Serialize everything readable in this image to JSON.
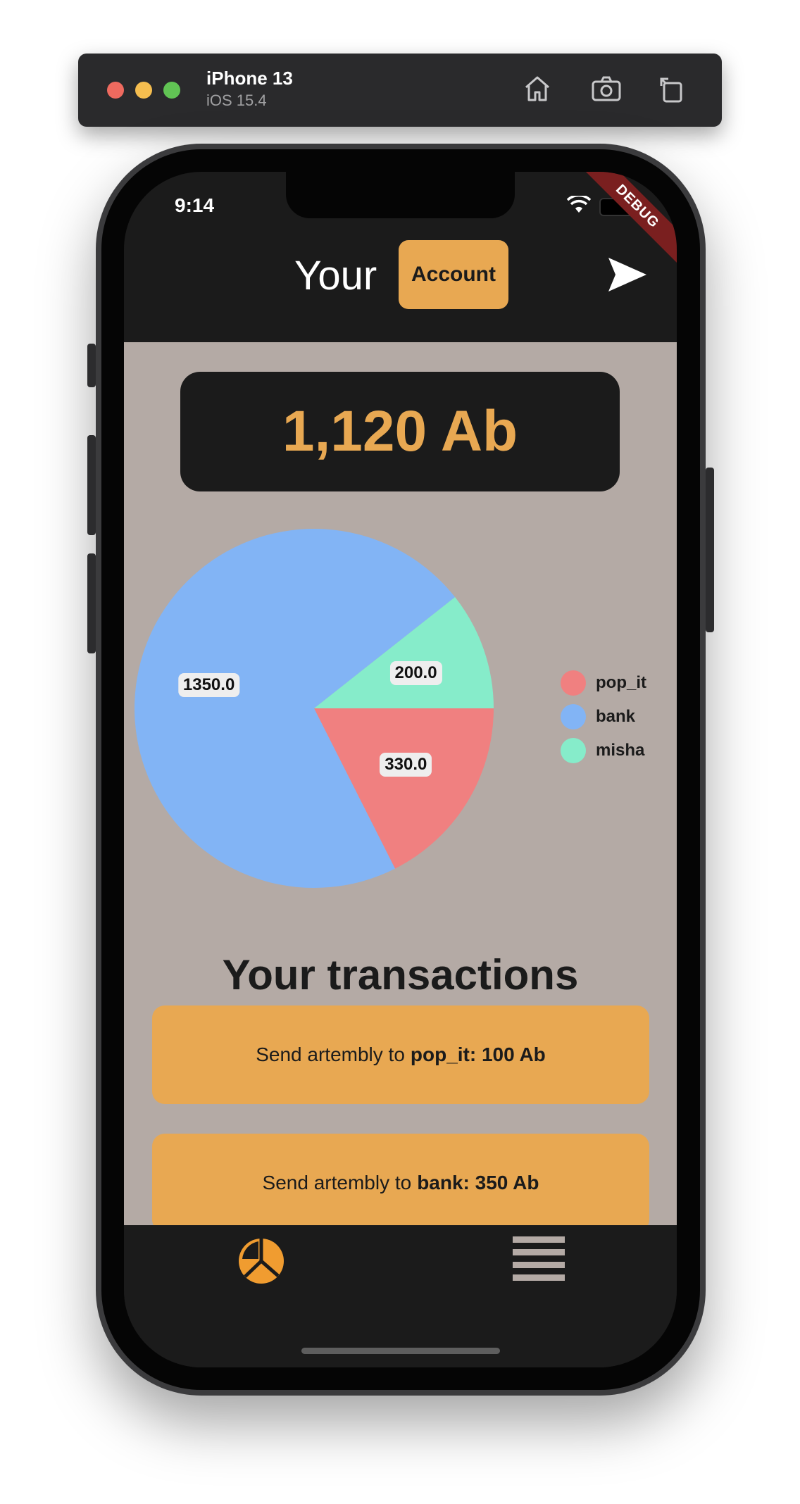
{
  "simulator": {
    "device_name": "iPhone 13",
    "os_version": "iOS 15.4",
    "toolbar_icons": [
      "home-icon",
      "screenshot-icon",
      "rotate-icon"
    ]
  },
  "status_bar": {
    "time": "9:14"
  },
  "debug_banner": "DEBUG",
  "app_bar": {
    "title": "Your",
    "account_button": "Account",
    "send_icon": "send-icon"
  },
  "balance": {
    "text": "1,120 Ab"
  },
  "chart_data": {
    "type": "pie",
    "slices": [
      {
        "label": "pop_it",
        "value": 330.0,
        "display": "330.0",
        "color": "#f08080"
      },
      {
        "label": "bank",
        "value": 1350.0,
        "display": "1350.0",
        "color": "#82b4f5"
      },
      {
        "label": "misha",
        "value": 200.0,
        "display": "200.0",
        "color": "#86ecca"
      }
    ],
    "legend_position": "right"
  },
  "transactions": {
    "title": "Your transactions",
    "items": [
      {
        "prefix": "Send artembly to",
        "detail": "pop_it: 100 Ab"
      },
      {
        "prefix": "Send artembly to",
        "detail": "bank: 350 Ab"
      }
    ]
  },
  "bottom_nav": {
    "items": [
      "pie-chart-icon",
      "list-icon"
    ]
  },
  "colors": {
    "accent": "#e8a852",
    "dark": "#1b1b1b",
    "content_bg": "#b4aaa5",
    "pop_it": "#f08080",
    "bank": "#82b4f5",
    "misha": "#86ecca"
  }
}
